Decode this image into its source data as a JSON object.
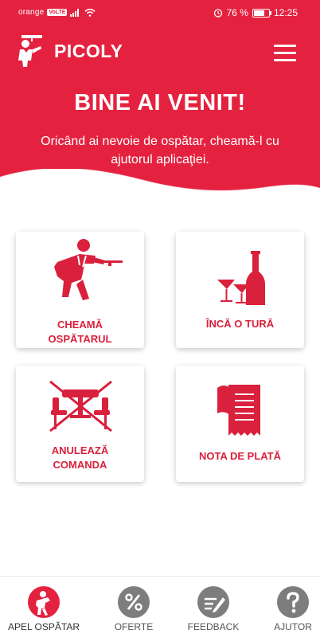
{
  "status_bar": {
    "carrier": "orange",
    "network_badge": "VoLTE",
    "battery": "76 %",
    "time": "12:25"
  },
  "app": {
    "brand": "PICOLY",
    "title": "BINE AI VENIT!",
    "subtitle": "Oricând ai nevoie de ospătar, cheamă-l cu ajutorul aplicaţiei."
  },
  "cards": [
    {
      "label": "CHEAMĂ\nOSPĂTARUL",
      "icon": "waiter-icon"
    },
    {
      "label": "ÎNCĂ O TURĂ",
      "icon": "drinks-icon"
    },
    {
      "label": "ANULEAZĂ\nCOMANDA",
      "icon": "cancel-table-icon"
    },
    {
      "label": "NOTA DE PLATĂ",
      "icon": "receipt-icon"
    }
  ],
  "bottom_nav": [
    {
      "label": "APEL OSPĂTAR",
      "icon": "waiter-icon",
      "active": true
    },
    {
      "label": "OFERTE",
      "icon": "percent-icon",
      "active": false
    },
    {
      "label": "FEEDBACK",
      "icon": "feedback-icon",
      "active": false
    },
    {
      "label": "AJUTOR",
      "icon": "help-icon",
      "active": false
    }
  ],
  "colors": {
    "accent": "#e4223f",
    "card_label": "#d9203c",
    "nav_inactive": "#7d7d7d"
  }
}
